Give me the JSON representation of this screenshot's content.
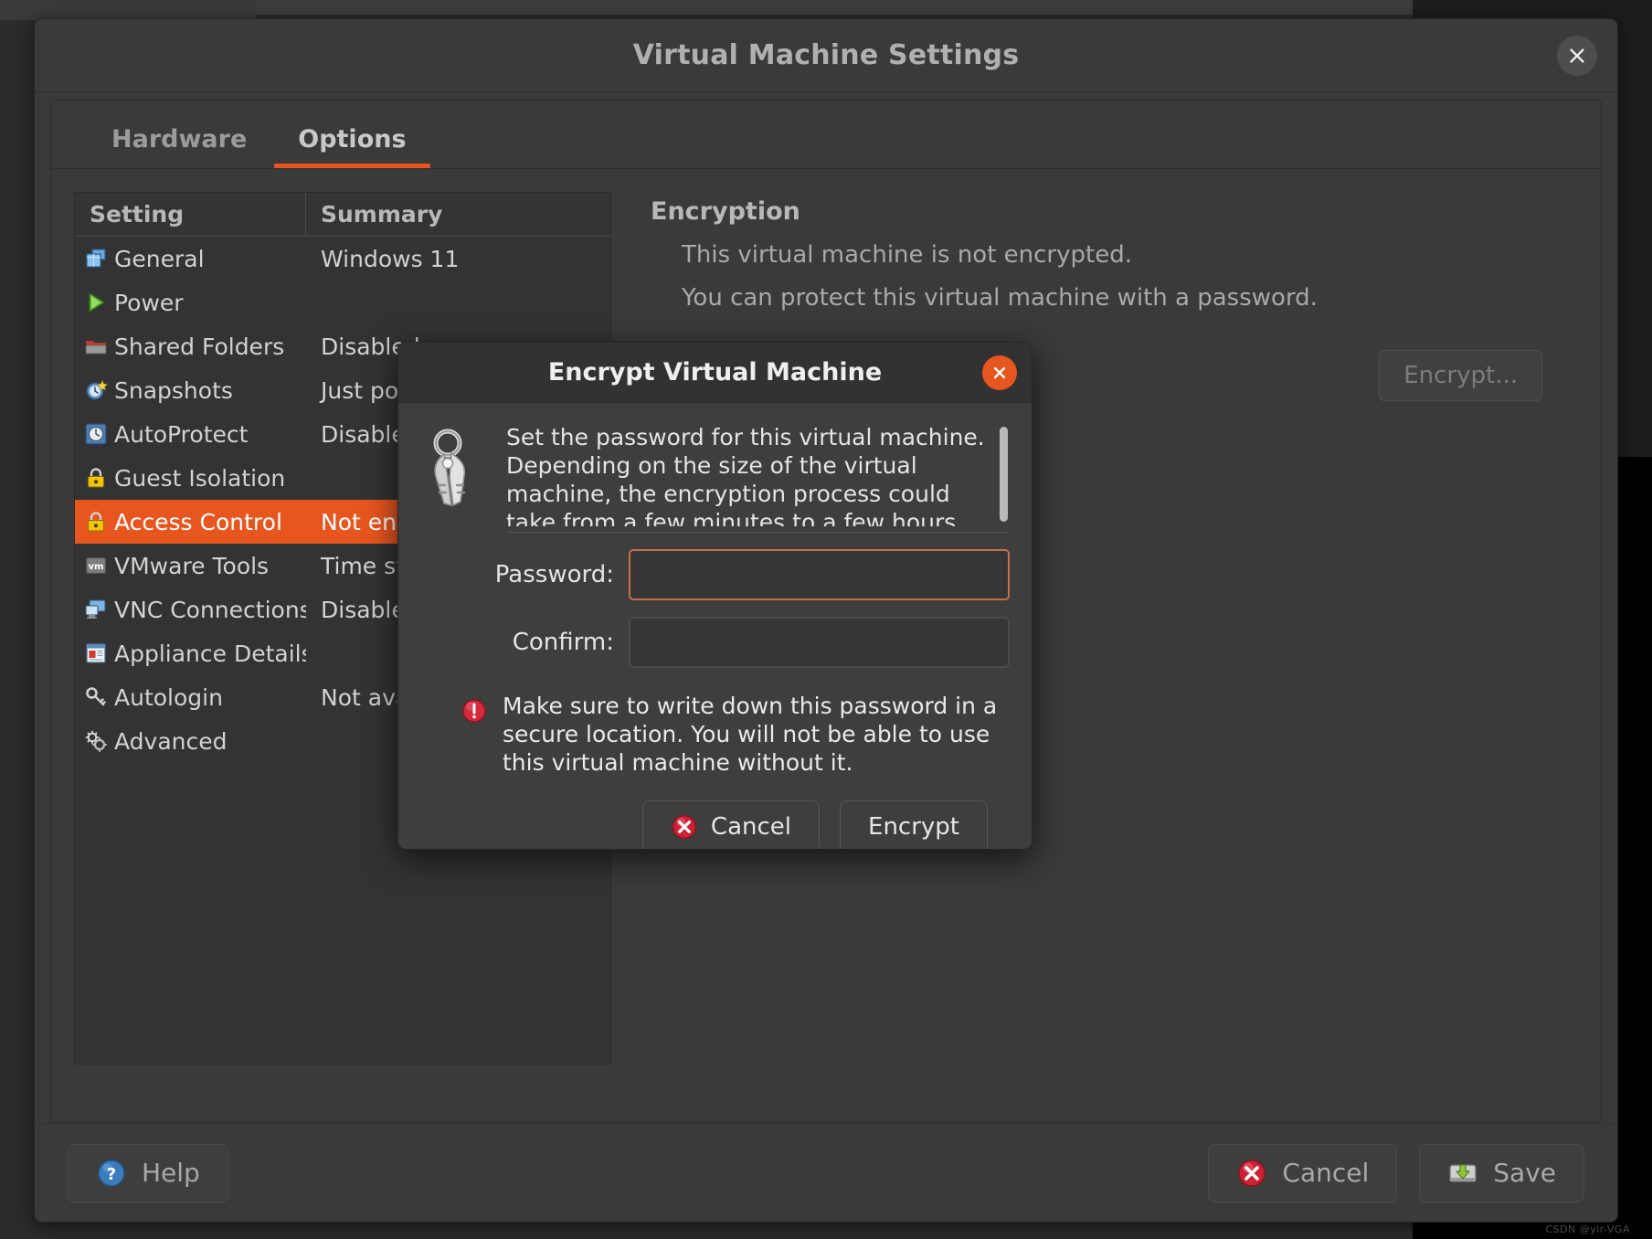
{
  "window": {
    "title": "Virtual Machine Settings",
    "close_icon": "close-icon"
  },
  "tabs": [
    {
      "label": "Hardware",
      "active": false
    },
    {
      "label": "Options",
      "active": true
    }
  ],
  "settings_table": {
    "columns": {
      "setting": "Setting",
      "summary": "Summary"
    },
    "rows": [
      {
        "label": "General",
        "summary": "Windows 11",
        "icon": "windows-stack-icon",
        "selected": false
      },
      {
        "label": "Power",
        "summary": "",
        "icon": "play-triangle-icon",
        "selected": false
      },
      {
        "label": "Shared Folders",
        "summary": "Disabled",
        "icon": "folder-icon",
        "selected": false
      },
      {
        "label": "Snapshots",
        "summary": "Just power off",
        "icon": "clock-star-icon",
        "selected": false
      },
      {
        "label": "AutoProtect",
        "summary": "Disabled",
        "icon": "shield-clock-icon",
        "selected": false
      },
      {
        "label": "Guest Isolation",
        "summary": "",
        "icon": "lock-icon",
        "selected": false
      },
      {
        "label": "Access Control",
        "summary": "Not encrypted",
        "icon": "lock-icon",
        "selected": true
      },
      {
        "label": "VMware Tools",
        "summary": "Time sync on",
        "icon": "vm-badge-icon",
        "selected": false
      },
      {
        "label": "VNC Connections",
        "summary": "Disabled",
        "icon": "monitor-icon",
        "selected": false
      },
      {
        "label": "Appliance Details",
        "summary": "",
        "icon": "document-icon",
        "selected": false
      },
      {
        "label": "Autologin",
        "summary": "Not available",
        "icon": "key-icon",
        "selected": false
      },
      {
        "label": "Advanced",
        "summary": "",
        "icon": "gears-icon",
        "selected": false
      }
    ]
  },
  "detail": {
    "title": "Encryption",
    "line1": "This virtual machine is not encrypted.",
    "line2": "You can protect this virtual machine with a password.",
    "encrypt_button": "Encrypt..."
  },
  "bottombar": {
    "help": "Help",
    "cancel": "Cancel",
    "save": "Save"
  },
  "modal": {
    "title": "Encrypt Virtual Machine",
    "description": "Set the password for this virtual machine. Depending on the size of the virtual machine, the encryption process could take from a few minutes to a few hours.",
    "password_label": "Password:",
    "password_value": "",
    "password_placeholder": "",
    "confirm_label": "Confirm:",
    "confirm_value": "",
    "confirm_placeholder": "",
    "warning": "Make sure to write down this password in a secure location. You will not be able to use this virtual machine without it.",
    "cancel_label": "Cancel",
    "encrypt_label": "Encrypt"
  },
  "colors": {
    "accent": "#e8561f",
    "window_bg": "#3a3a3a",
    "list_bg": "#333333",
    "focus_border": "#c4704a",
    "danger": "#d42a3c"
  },
  "watermark": "CSDN @ylr-VGA"
}
